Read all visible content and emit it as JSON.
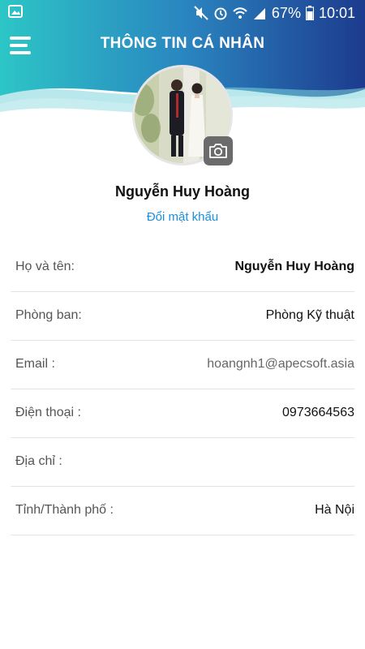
{
  "status_bar": {
    "battery": "67%",
    "time": "10:01"
  },
  "header": {
    "title": "THÔNG TIN CÁ NHÂN"
  },
  "profile": {
    "name": "Nguyễn Huy Hoàng",
    "change_password": "Đổi mật khẩu"
  },
  "fields": [
    {
      "label": "Họ và tên:",
      "value": "Nguyễn Huy Hoàng"
    },
    {
      "label": "Phòng ban:",
      "value": "Phòng Kỹ thuật"
    },
    {
      "label": "Email :",
      "value": "hoangnh1@apecsoft.asia"
    },
    {
      "label": "Điện thoại :",
      "value": "0973664563"
    },
    {
      "label": "Địa chỉ :",
      "value": ""
    },
    {
      "label": "Tỉnh/Thành phố :",
      "value": "Hà Nội"
    }
  ],
  "colors": {
    "header_gradient_start": "#2ec4c4",
    "header_gradient_end": "#1e3f8f",
    "link": "#1a8fe0"
  },
  "icons": {
    "menu": "hamburger-icon",
    "camera": "camera-icon",
    "gallery": "gallery-icon",
    "mute": "mute-icon",
    "alarm": "alarm-icon",
    "wifi": "wifi-icon",
    "signal": "signal-icon",
    "battery": "battery-icon"
  }
}
